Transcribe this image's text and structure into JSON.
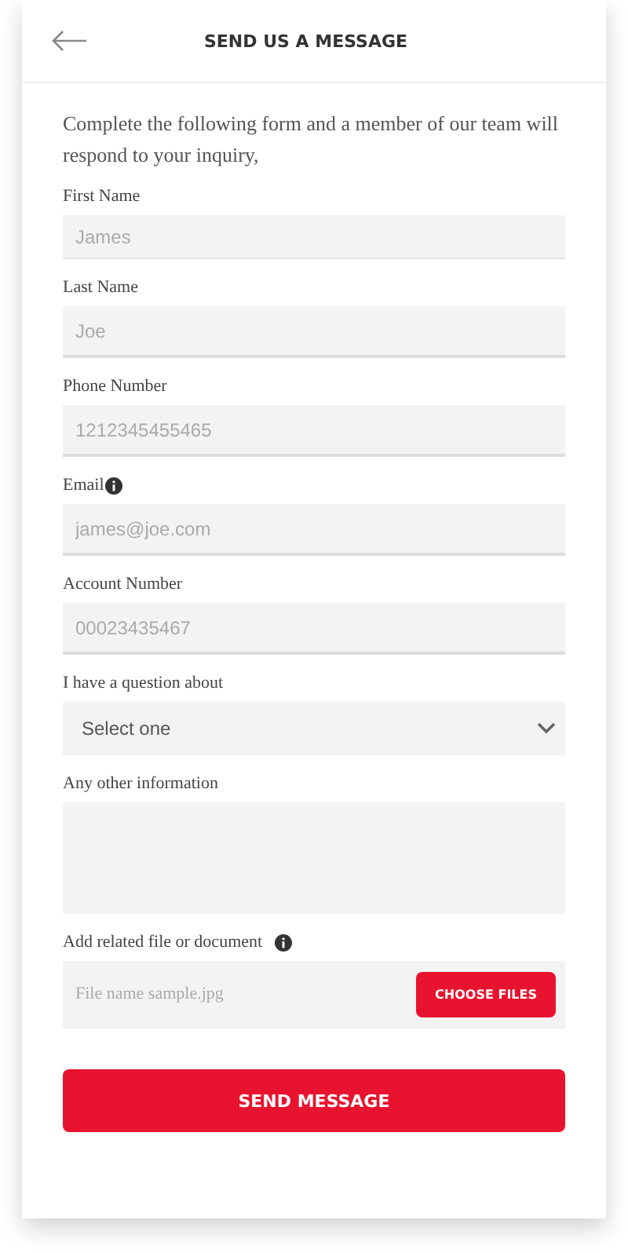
{
  "header": {
    "title": "SEND US A MESSAGE"
  },
  "intro": "Complete the following form and a member of our team will respond to your inquiry,",
  "fields": [
    {
      "kind": "text",
      "label": "First Name",
      "placeholder": "James",
      "info": false
    },
    {
      "kind": "text",
      "label": "Last Name",
      "placeholder": "Joe",
      "info": false
    },
    {
      "kind": "text",
      "label": "Phone Number",
      "placeholder": "1212345455465",
      "info": false
    },
    {
      "kind": "text",
      "label": "Email",
      "placeholder": "james@joe.com",
      "info": true
    },
    {
      "kind": "text",
      "label": "Account Number",
      "placeholder": "00023435467",
      "info": false
    },
    {
      "kind": "select",
      "label": "I have a question about",
      "value": "Select one",
      "info": false
    },
    {
      "kind": "textarea",
      "label": "Any other information",
      "info": false
    },
    {
      "kind": "file",
      "label": "Add related file or document",
      "placeholder": "File name sample.jpg",
      "button": "CHOOSE FILES",
      "info": true
    }
  ],
  "submit": "SEND MESSAGE"
}
